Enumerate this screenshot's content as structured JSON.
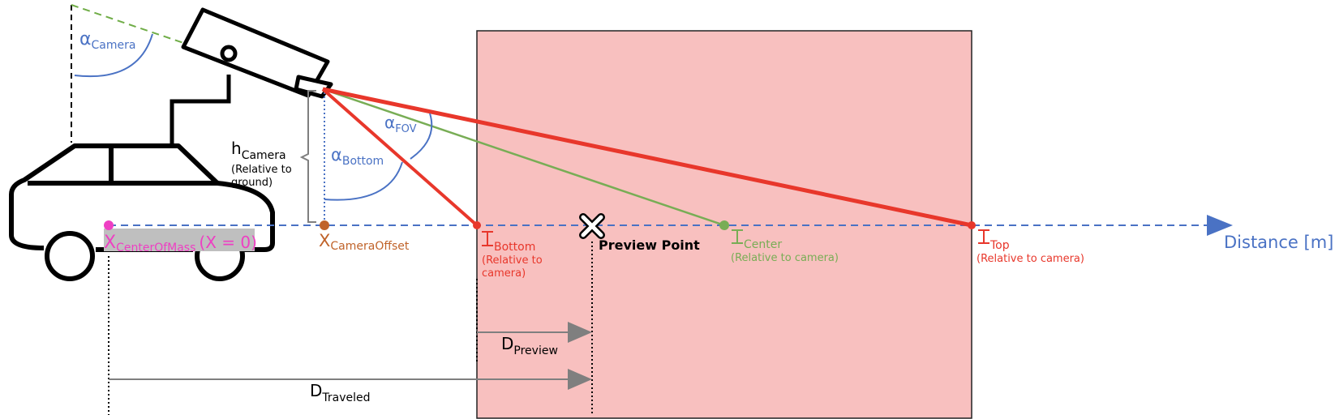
{
  "colors": {
    "background": "#ffffff",
    "view_area_fill": "#f8c0bf",
    "view_area_stroke": "#222222",
    "vehicle": "#000000",
    "ray_outer": "#e8372b",
    "ray_center": "#78ad55",
    "angle_blue": "#4a72c4",
    "ground_axis": "#4a72c4",
    "sight_dash": "#70ad47",
    "camera_offset": "#c0632a",
    "center_of_mass": "#ee3fc3",
    "highlight_box": "#bfbfbf",
    "arrow_gray": "#7f7f7f",
    "text_black": "#000000"
  },
  "labels": {
    "alpha_camera": {
      "main": "α",
      "sub": "Camera"
    },
    "alpha_fov": {
      "main": "α",
      "sub": "FOV"
    },
    "alpha_bottom": {
      "main": "α",
      "sub": "Bottom"
    },
    "h_camera": {
      "main": "h",
      "sub": "Camera",
      "note_line1": "(Relative to",
      "note_line2": "ground)"
    },
    "x_center_of_mass": {
      "main": "X",
      "sub": "CenterOfMass",
      "suffix": "(X = 0)"
    },
    "x_camera_offset": {
      "main": "X",
      "sub": "CameraOffset"
    },
    "i_bottom": {
      "sub": "Bottom",
      "note_line1": "(Relative to",
      "note_line2": "camera)"
    },
    "i_center": {
      "sub": "Center",
      "note": "(Relative to camera)"
    },
    "i_top": {
      "sub": "Top",
      "note": "(Relative to camera)"
    },
    "preview_point": "Preview Point",
    "distance_axis": "Distance [m]",
    "d_preview": {
      "main": "D",
      "sub": "Preview"
    },
    "d_traveled": {
      "main": "D",
      "sub": "Traveled"
    }
  }
}
